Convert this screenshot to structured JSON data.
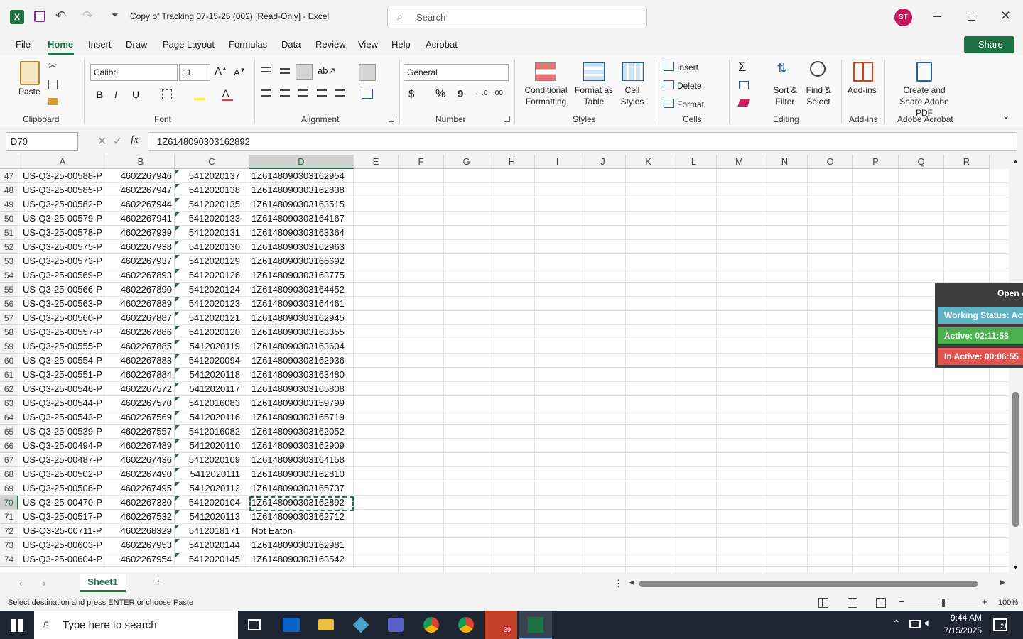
{
  "window": {
    "title": "Copy of Tracking 07-15-25 (002)  [Read-Only]  -  Excel",
    "search_placeholder": "Search",
    "user_initials": "ST",
    "share_label": "Share"
  },
  "menu": [
    "File",
    "Home",
    "Insert",
    "Draw",
    "Page Layout",
    "Formulas",
    "Data",
    "Review",
    "View",
    "Help",
    "Acrobat"
  ],
  "ribbon": {
    "clipboard": {
      "paste": "Paste",
      "group": "Clipboard"
    },
    "font": {
      "name": "Calibri",
      "size": "11",
      "bold": "B",
      "italic": "I",
      "underline": "U",
      "group": "Font"
    },
    "alignment": {
      "group": "Alignment"
    },
    "number": {
      "format": "General",
      "currency": "$",
      "percent": "%",
      "comma": "9",
      "group": "Number"
    },
    "styles": {
      "conditional": "Conditional Formatting",
      "format_table": "Format as Table",
      "cell_styles": "Cell Styles",
      "group": "Styles"
    },
    "cells": {
      "insert": "Insert",
      "delete": "Delete",
      "format": "Format",
      "group": "Cells"
    },
    "editing": {
      "sort": "Sort & Filter",
      "find": "Find & Select",
      "group": "Editing"
    },
    "addins": {
      "label": "Add-ins",
      "group": "Add-ins"
    },
    "acrobat": {
      "label": "Create and Share Adobe PDF",
      "group": "Adobe Acrobat"
    }
  },
  "formula_bar": {
    "name_box": "D70",
    "fx": "fx",
    "value": "1Z6148090303162892"
  },
  "columns": [
    "A",
    "B",
    "C",
    "D",
    "E",
    "F",
    "G",
    "H",
    "I",
    "J",
    "K",
    "L",
    "M",
    "N",
    "O",
    "P",
    "Q",
    "R"
  ],
  "rows": [
    {
      "n": "47",
      "a": "US-Q3-25-00588-P",
      "b": "4602267946",
      "c": "5412020137",
      "d": "1Z6148090303162954"
    },
    {
      "n": "48",
      "a": "US-Q3-25-00585-P",
      "b": "4602267947",
      "c": "5412020138",
      "d": "1Z6148090303162838"
    },
    {
      "n": "49",
      "a": "US-Q3-25-00582-P",
      "b": "4602267944",
      "c": "5412020135",
      "d": "1Z6148090303163515"
    },
    {
      "n": "50",
      "a": "US-Q3-25-00579-P",
      "b": "4602267941",
      "c": "5412020133",
      "d": "1Z6148090303164167"
    },
    {
      "n": "51",
      "a": "US-Q3-25-00578-P",
      "b": "4602267939",
      "c": "5412020131",
      "d": "1Z6148090303163364"
    },
    {
      "n": "52",
      "a": "US-Q3-25-00575-P",
      "b": "4602267938",
      "c": "5412020130",
      "d": "1Z6148090303162963"
    },
    {
      "n": "53",
      "a": "US-Q3-25-00573-P",
      "b": "4602267937",
      "c": "5412020129",
      "d": "1Z6148090303166692"
    },
    {
      "n": "54",
      "a": "US-Q3-25-00569-P",
      "b": "4602267893",
      "c": "5412020126",
      "d": "1Z6148090303163775"
    },
    {
      "n": "55",
      "a": "US-Q3-25-00566-P",
      "b": "4602267890",
      "c": "5412020124",
      "d": "1Z6148090303164452"
    },
    {
      "n": "56",
      "a": "US-Q3-25-00563-P",
      "b": "4602267889",
      "c": "5412020123",
      "d": "1Z6148090303164461"
    },
    {
      "n": "57",
      "a": "US-Q3-25-00560-P",
      "b": "4602267887",
      "c": "5412020121",
      "d": "1Z6148090303162945"
    },
    {
      "n": "58",
      "a": "US-Q3-25-00557-P",
      "b": "4602267886",
      "c": "5412020120",
      "d": "1Z6148090303163355"
    },
    {
      "n": "59",
      "a": "US-Q3-25-00555-P",
      "b": "4602267885",
      "c": "5412020119",
      "d": "1Z6148090303163604"
    },
    {
      "n": "60",
      "a": "US-Q3-25-00554-P",
      "b": "4602267883",
      "c": "5412020094",
      "d": "1Z6148090303162936"
    },
    {
      "n": "61",
      "a": "US-Q3-25-00551-P",
      "b": "4602267884",
      "c": "5412020118",
      "d": "1Z6148090303163480"
    },
    {
      "n": "62",
      "a": "US-Q3-25-00546-P",
      "b": "4602267572",
      "c": "5412020117",
      "d": "1Z6148090303165808"
    },
    {
      "n": "63",
      "a": "US-Q3-25-00544-P",
      "b": "4602267570",
      "c": "5412016083",
      "d": "1Z6148090303159799"
    },
    {
      "n": "64",
      "a": "US-Q3-25-00543-P",
      "b": "4602267569",
      "c": "5412020116",
      "d": "1Z6148090303165719"
    },
    {
      "n": "65",
      "a": "US-Q3-25-00539-P",
      "b": "4602267557",
      "c": "5412016082",
      "d": "1Z6148090303162052"
    },
    {
      "n": "66",
      "a": "US-Q3-25-00494-P",
      "b": "4602267489",
      "c": "5412020110",
      "d": "1Z6148090303162909"
    },
    {
      "n": "67",
      "a": "US-Q3-25-00487-P",
      "b": "4602267436",
      "c": "5412020109",
      "d": "1Z6148090303164158"
    },
    {
      "n": "68",
      "a": "US-Q3-25-00502-P",
      "b": "4602267490",
      "c": "5412020111",
      "d": "1Z6148090303162810"
    },
    {
      "n": "69",
      "a": "US-Q3-25-00508-P",
      "b": "4602267495",
      "c": "5412020112",
      "d": "1Z6148090303165737"
    },
    {
      "n": "70",
      "a": "US-Q3-25-00470-P",
      "b": "4602267330",
      "c": "5412020104",
      "d": "1Z6148090303162892"
    },
    {
      "n": "71",
      "a": "US-Q3-25-00517-P",
      "b": "4602267532",
      "c": "5412020113",
      "d": "1Z6148090303162712"
    },
    {
      "n": "72",
      "a": "US-Q3-25-00711-P",
      "b": "4602268329",
      "c": "5412018171",
      "d": "Not Eaton"
    },
    {
      "n": "73",
      "a": "US-Q3-25-00603-P",
      "b": "4602267953",
      "c": "5412020144",
      "d": "1Z6148090303162981"
    },
    {
      "n": "74",
      "a": "US-Q3-25-00604-P",
      "b": "4602267954",
      "c": "5412020145",
      "d": "1Z6148090303163542"
    }
  ],
  "selected_row": "70",
  "sheet": {
    "tab": "Sheet1"
  },
  "status": {
    "message": "Select destination and press ENTER or choose Paste",
    "zoom": "100%"
  },
  "widget": {
    "open": "Open A",
    "working": "Working Status: Act",
    "active": "Active: 02:11:58",
    "inactive": "In Active: 00:06:55",
    "colors": {
      "working": "#5fb3c4",
      "active": "#4caf50",
      "inactive": "#e05550"
    }
  },
  "taskbar": {
    "search": "Type here to search",
    "time": "9:44 AM",
    "date": "7/15/2025",
    "notif": "21",
    "zoom_badge": "39"
  },
  "colors": {
    "excel_green": "#1e7145",
    "accent_pink": "#c2185b"
  }
}
